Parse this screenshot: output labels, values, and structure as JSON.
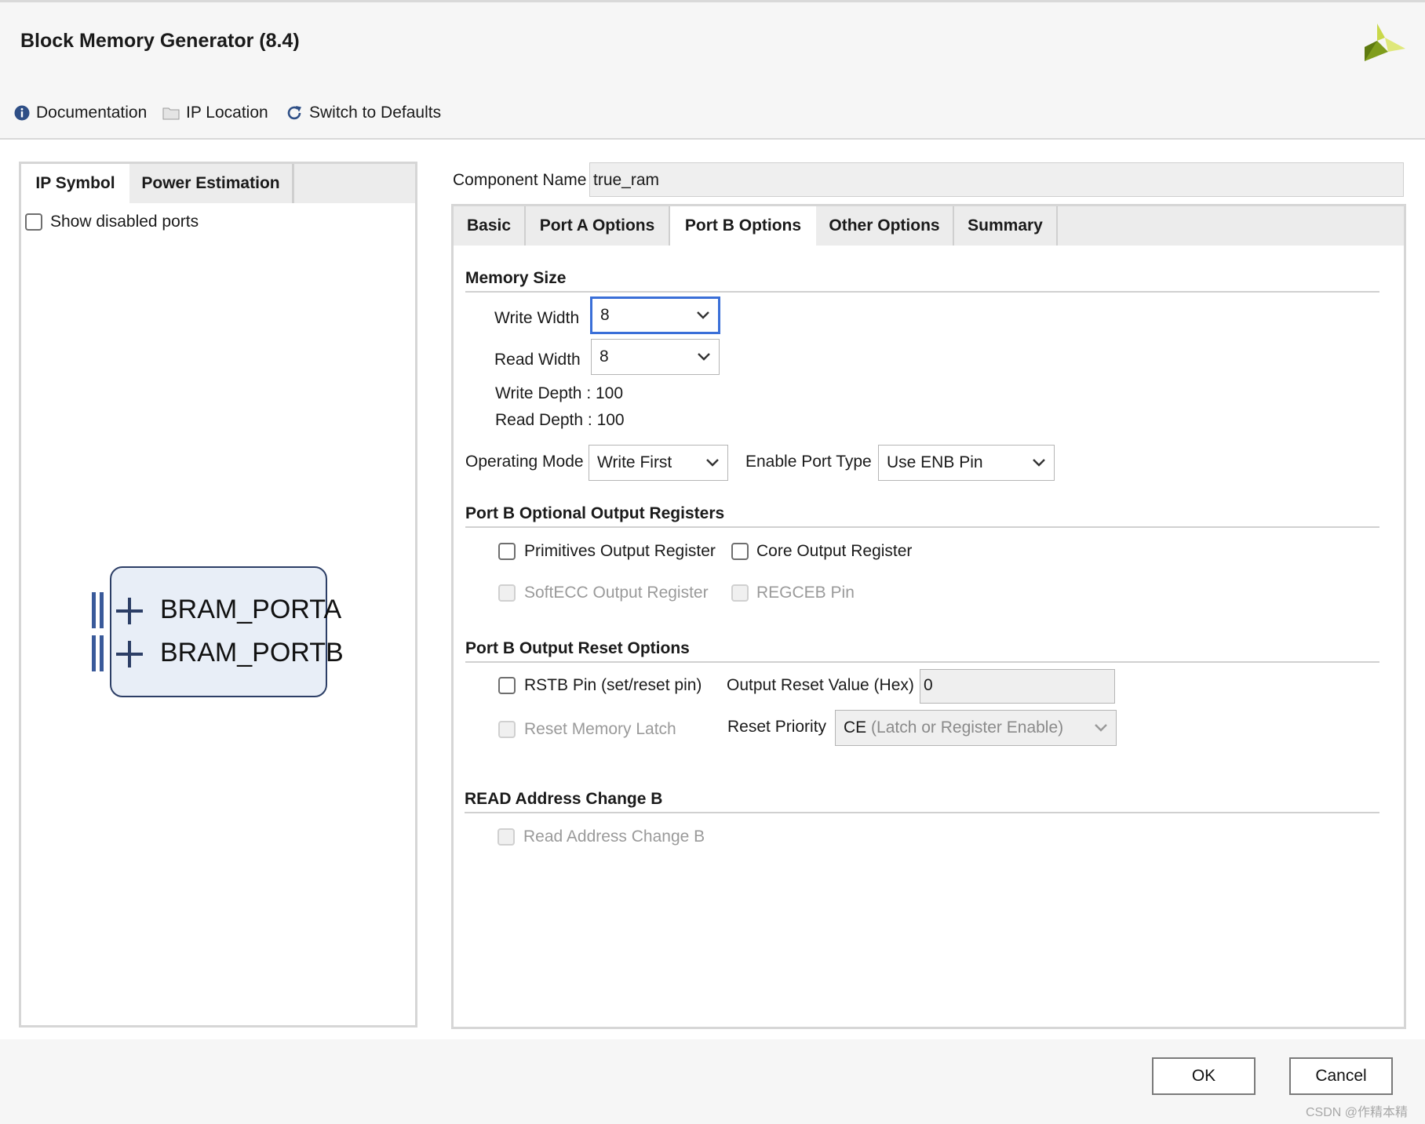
{
  "window": {
    "title": "Block Memory Generator (8.4)"
  },
  "toolbar": {
    "documentation": "Documentation",
    "ip_location": "IP Location",
    "switch_defaults": "Switch to Defaults"
  },
  "left_panel": {
    "tabs": [
      {
        "label": "IP Symbol",
        "active": true
      },
      {
        "label": "Power Estimation",
        "active": false
      }
    ],
    "show_disabled_ports": "Show disabled ports",
    "symbol": {
      "ports": [
        "BRAM_PORTA",
        "BRAM_PORTB"
      ]
    }
  },
  "component": {
    "label": "Component Name",
    "value": "true_ram"
  },
  "right_tabs": [
    {
      "label": "Basic",
      "active": false
    },
    {
      "label": "Port A Options",
      "active": false
    },
    {
      "label": "Port B Options",
      "active": true
    },
    {
      "label": "Other Options",
      "active": false
    },
    {
      "label": "Summary",
      "active": false
    }
  ],
  "memory_size": {
    "title": "Memory Size",
    "write_width_label": "Write Width",
    "write_width_value": "8",
    "read_width_label": "Read Width",
    "read_width_value": "8",
    "write_depth": "Write Depth : 100",
    "read_depth": "Read Depth : 100",
    "operating_mode_label": "Operating Mode",
    "operating_mode_value": "Write First",
    "enable_port_type_label": "Enable Port Type",
    "enable_port_type_value": "Use ENB Pin"
  },
  "optional_output_registers": {
    "title": "Port B Optional Output Registers",
    "primitives": "Primitives Output Register",
    "core": "Core Output Register",
    "softecc": "SoftECC Output Register",
    "regceb": "REGCEB Pin"
  },
  "output_reset": {
    "title": "Port B Output Reset Options",
    "rstb": "RSTB Pin (set/reset pin)",
    "output_reset_value_label": "Output Reset Value (Hex)",
    "output_reset_value": "0",
    "reset_memory_latch": "Reset Memory Latch",
    "reset_priority_label": "Reset Priority",
    "reset_priority_value_prefix": "CE",
    "reset_priority_value_rest": " (Latch or Register Enable)"
  },
  "read_address_change": {
    "title": "READ Address Change B",
    "option": "Read Address Change B"
  },
  "buttons": {
    "ok": "OK",
    "cancel": "Cancel"
  },
  "watermark": "CSDN @作精本精",
  "colors": {
    "accent_focus": "#3a6fd8",
    "symbol_fill": "#e8eef7",
    "symbol_port": "#3a5a9a",
    "logo": "#8fb320"
  }
}
